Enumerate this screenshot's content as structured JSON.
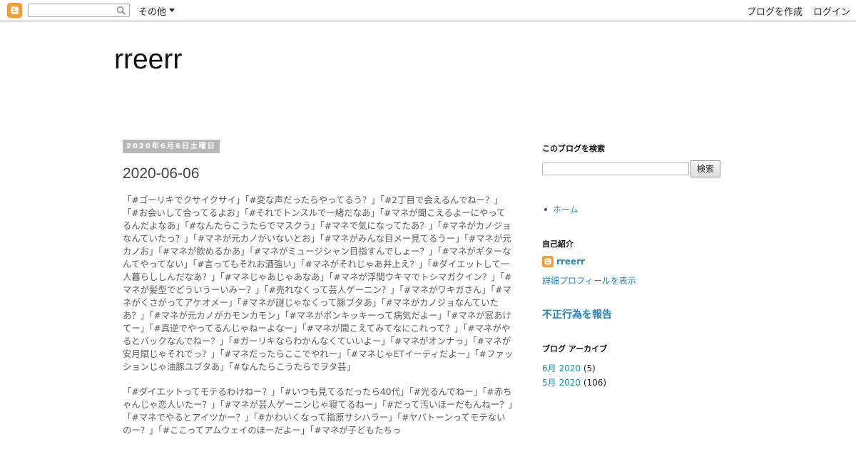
{
  "navbar": {
    "logo_icon": "blogger-icon",
    "search_placeholder": "",
    "more_label": "その他",
    "create_blog_label": "ブログを作成",
    "login_label": "ログイン"
  },
  "header": {
    "blog_title": "rreerr"
  },
  "post": {
    "date_header": "2020年6月6日土曜日",
    "title": "2020-06-06",
    "paragraphs": [
      "「#ゴーリキでクサイクサイ」「#変な声だったらやってるう？」「#2丁目で会えるんでねー？」「#お会いして合ってるよお」「#それでトンスルで一緒だなあ」「#マネが聞こえるよーにやってるんだよなあ」「#なんたらこうたらでマスクう」「#マネで気になってたあ？」「#マネがカノジョなんていたっ？」「#マネが元カノがいないとお」「#マネがみんな目メー見てるうー」「#マネが元カノお」「#マネが飲めるかあ」「#マネがミュージシャン目指すんでしょー？」「#マネがギターなんてやってない」「#言ってもそれお酒強い」「#マネがそれじゃあ井上え？」「#ダイエットして一人暮らししんだなあ？」「#マネじゃあじゃあなあ」「#マネが浮間ウキマでトシマガクイン？」「#マネが髪型でどういうーいみー？」「#売れなくって芸人ゲーニン？」「#マネがワキガさん」「#マネがくさがってアケオメー」「#マネが謎じゃなくって豚ブタあ」「#マネがカノジョなんていたあ？」「#マネが元カノがカモンカモン」「#マネがポンキッキーって病気だよー」「#マネが窓あけてー」「#真逆でやってるんじゃねーよなー」「#マネが聞こえてみてなにこれって？」「#マネがやるとバックなんでねー？」「#ガーリキならわかんなくていいよー」「#マネがオンナっ」「#マネが安月賦じゃそれでっ？」「#マネだったらここでやれー」「#マネじゃETイーティだよー」「#ファッションじゃ油豚ユブタあ」「#なんたらこうたらでヲタ芸」",
      "「#ダイエットってモテるわけねー？」「#いつも見てるだったら40代」「#光るんでねー」「#赤ちゃんじゃ恋人いたー？」「#マネが芸人ゲーニンじゃ寝てるねー」「#だって汚いほーだもんねー？」「#マネでやるとアイツかー？」「#かわいくなって指原サシハラー」「#ヤバトーンってモテないのー？」「#ここってアムウェイのほーだよー」「#マネが子どもたちっ"
    ]
  },
  "sidebar": {
    "search_heading": "このブログを検索",
    "search_button": "検索",
    "pages": [
      {
        "label": "ホーム"
      }
    ],
    "profile_heading": "自己紹介",
    "profile_name": "rreerr",
    "profile_link": "詳細プロフィールを表示",
    "report_abuse": "不正行為を報告",
    "archive_heading": "ブログ アーカイブ",
    "archive": [
      {
        "label": "6月 2020",
        "count": "(5)"
      },
      {
        "label": "5月 2020",
        "count": "(106)"
      }
    ]
  },
  "colors": {
    "link": "#2288bb",
    "blogger_orange": "#f29d3a",
    "date_header_bg": "#b8b8b8"
  }
}
